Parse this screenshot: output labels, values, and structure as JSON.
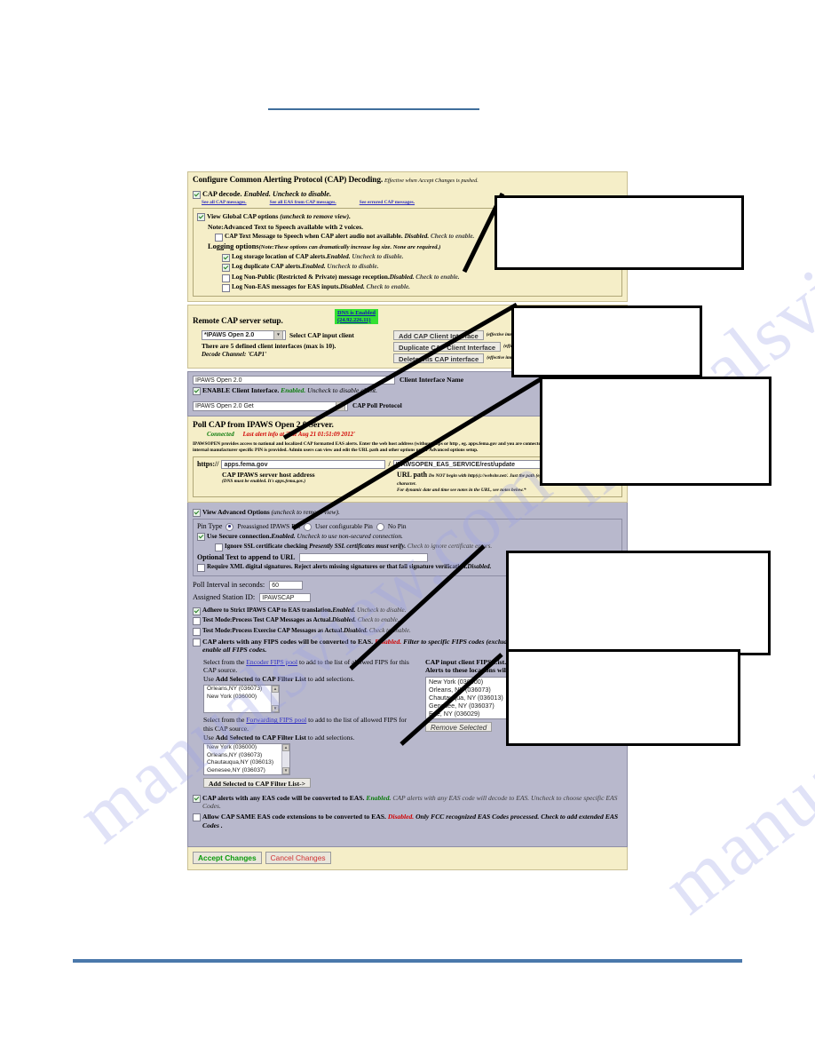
{
  "page": {
    "watermark_text": "manualsview.com"
  },
  "cap_decoding": {
    "title": "Configure Common Alerting Protocol (CAP) Decoding.",
    "title_note": "Effective when Accept Changes is pushed.",
    "cap_decode": {
      "label": "CAP decode.",
      "state": "Enabled.",
      "hint": "Uncheck to disable.",
      "checked": true
    },
    "links": [
      "See all CAP messages.",
      "See all EAS from CAP messages.",
      "See errored CAP messages."
    ],
    "view_global": {
      "label": "View Global CAP options",
      "hint": "(uncheck to remove view).",
      "checked": true
    },
    "tts_note": "Note:Advanced Text to Speech available with 2 voices.",
    "tts_option": {
      "label": "CAP Text Message to Speech when CAP alert audio not available.",
      "state": "Disabled.",
      "hint": "Check to enable.",
      "checked": false
    },
    "logging_heading": "Logging options",
    "logging_note": "(Note:These options can dramatically increase log size. None are required.)",
    "logging_options": [
      {
        "label": "Log storage location of CAP alerts.",
        "state": "Enabled.",
        "hint": "Uncheck to disable.",
        "checked": true
      },
      {
        "label": "Log duplicate CAP alerts.",
        "state": "Enabled.",
        "hint": "Uncheck to disable.",
        "checked": true
      },
      {
        "label": "Log Non-Public (Restricted & Private) message reception.",
        "state": "Disabled.",
        "hint": "Check to enable.",
        "checked": false
      },
      {
        "label": "Log Non-EAS messages for EAS inputs.",
        "state": "Disabled.",
        "hint": "Check to enable.",
        "checked": false
      }
    ]
  },
  "remote_cap": {
    "title": "Remote CAP server setup.",
    "dns_line1": "DNS is Enabled",
    "dns_line2": "(24.92.226.11)",
    "client_select": "*IPAWS Open 2.0",
    "client_select_label": "Select CAP input client",
    "defined_line": "There are 5 defined client interfaces (max is 10).",
    "decode_channel": "Decode Channel: 'CAP1'",
    "buttons": [
      {
        "label": "Add CAP Client Interface",
        "note": "(effective immediately)"
      },
      {
        "label": "Duplicate CAP Client Interface",
        "note": "(effective immediately)"
      },
      {
        "label": "Delete this CAP interface",
        "note": "(effective immediately)"
      }
    ]
  },
  "client_interface": {
    "name_value": "IPAWS Open 2.0",
    "name_label": "Client Interface Name",
    "enable": {
      "label": "ENABLE Client Interface.",
      "state": "Enabled.",
      "hint": "Uncheck to disable client.",
      "checked": true
    },
    "protocol_value": "IPAWS Open 2.0 Get",
    "protocol_label": "CAP Poll Protocol"
  },
  "poll_cap": {
    "title": "Poll CAP from IPAWS Open 2.0 Server.",
    "status": "Connected",
    "last_alert": "Last alert info at 'Tue Aug 21 01:51:09 2012'",
    "description": "IPAWSOPEN provides access to national and localized CAP formatted EAS alerts. Enter the web host address (without https or http , eg. apps.fema.gov and you are connected once the IPAWS URL path and internal manufacturer specific PIN is provided. Admin users can view and edit the URL path and other options under Advanced options setup.",
    "scheme_label": "https://",
    "host_value": "apps.fema.gov",
    "path_sep": "/",
    "path_value": "IPAWSOPEN_EAS_SERVICE/rest/update",
    "host_caption": "CAP IPAWS server host address",
    "host_subcaption": "(DNS must be enabled. It's apps.fema.gov.)",
    "path_caption": "URL path",
    "path_note1": "Do NOT begin with http(s)://website.net/. Just the path (eg. cap / alerts.xml), without a leading / character.",
    "path_note2": "For dynamic date and time see notes in the URL, see notes below.*"
  },
  "advanced": {
    "view_advanced": {
      "label": "View Advanced Options",
      "hint": "(uncheck to remove view).",
      "checked": true
    },
    "pin_type_label": "Pin Type",
    "pin_options": [
      {
        "label": "Preassigned IPAWS Pin",
        "selected": true
      },
      {
        "label": "User configurable Pin",
        "selected": false
      },
      {
        "label": "No Pin",
        "selected": false
      }
    ],
    "secure": {
      "label": "Use Secure connection.",
      "state": "Enabled.",
      "hint": "Uncheck to use non-secured connection.",
      "checked": true
    },
    "ignore_ssl": {
      "label": "Ignore SSL certificate checking",
      "state": "Presently SSL certificates must verify.",
      "hint": "Check to ignore certificate errors.",
      "checked": false
    },
    "optional_text_label": "Optional Text to append to URL",
    "optional_text_value": "",
    "require_xml": {
      "label": "Require XML digital signatures. Reject alerts missing signatures or that fail signature verification.",
      "state": "Disabled.",
      "checked": false
    }
  },
  "poll_settings": {
    "poll_interval_label": "Poll Interval in seconds:",
    "poll_interval_value": "60",
    "station_id_label": "Assigned Station ID:",
    "station_id_value": "IPAWSCAP",
    "checkboxes": [
      {
        "label": "Adhere to Strict IPAWS CAP to EAS translation.",
        "state": "Enabled.",
        "hint": "Uncheck to disable.",
        "checked": true
      },
      {
        "label": "Test Mode:Process Test CAP Messages as Actual.",
        "state": "Disabled.",
        "hint": "Check to enable.",
        "checked": false
      },
      {
        "label": "Test Mode:Process Exercise CAP Messages as Actual.",
        "state": "Disabled.",
        "hint": "Check to enable.",
        "checked": false
      }
    ],
    "fips_all": {
      "label": "CAP alerts with any FIPS codes will be converted to EAS.",
      "state": "Disabled.",
      "hint": "Filter to specific FIPS codes (excluding EAN/EAT override). Check to enable all FIPS codes.",
      "checked": false
    }
  },
  "fips": {
    "encoder_pool": {
      "prefix": "Select from the",
      "link": "Encoder FIPS pool",
      "suffix": "to add to the list of allowed FIPS for this CAP source.",
      "use_line_prefix": "Use",
      "use_line_bold": "Add Selected to CAP Filter List",
      "use_line_suffix": "to add selections.",
      "options": [
        "Orleans,NY (036073)",
        "New York (036000)"
      ]
    },
    "forwarding_pool": {
      "prefix": "Select from the",
      "link": "Forwarding FIPS pool",
      "suffix": "to add to the list of allowed FIPS for this CAP source.",
      "use_line_prefix": "Use",
      "use_line_bold": "Add Selected to CAP Filter List",
      "use_line_suffix": "to add selections.",
      "options": [
        "New York (036000)",
        "Orleans,NY (036073)",
        "Chautauqua,NY (036013)",
        "Genesee,NY (036037)"
      ]
    },
    "add_button": "Add Selected to CAP Filter List->",
    "client_list_title": "CAP input client FIPS List.",
    "client_list_subtitle": "Alerts to these locations will be sent to this CAP input client.",
    "client_list_options": [
      "New York (036000)",
      "Orleans, NY (036073)",
      "Chautauqua, NY (036013)",
      "Genesee, NY (036037)",
      "Erie, NY (036029)"
    ],
    "remove_button": "Remove Selected"
  },
  "eas_codes": {
    "any_eas": {
      "label": "CAP alerts with any EAS code will be converted to EAS.",
      "state": "Enabled.",
      "hint": "CAP alerts with any EAS code will decode to EAS. Uncheck to choose specific EAS Codes.",
      "checked": true
    },
    "same_ext": {
      "label": "Allow CAP SAME EAS code extensions to be converted to EAS.",
      "state": "Disabled.",
      "hint": "Only FCC recognized EAS Codes processed. Check to add extended EAS Codes .",
      "checked": false
    }
  },
  "footer": {
    "accept": "Accept Changes",
    "cancel": "Cancel Changes"
  },
  "callouts": [
    {
      "name": "callout-box-1",
      "text": ""
    },
    {
      "name": "callout-box-2",
      "text": ""
    },
    {
      "name": "callout-box-3",
      "text": ""
    },
    {
      "name": "callout-box-4",
      "text": ""
    },
    {
      "name": "callout-box-5",
      "text": ""
    }
  ]
}
